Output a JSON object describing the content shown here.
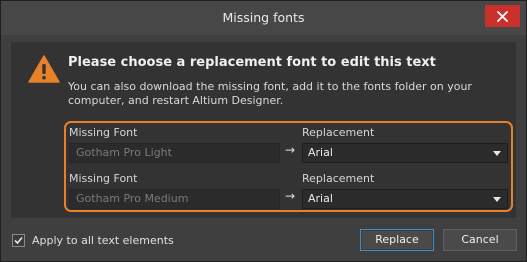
{
  "dialog": {
    "title": "Missing fonts",
    "close_icon": "close-icon"
  },
  "message": {
    "icon": "warning-icon",
    "heading": "Please choose a replacement font to edit this text",
    "description": "You can also download the missing font, add it to the fonts folder on your computer, and restart Altium Designer."
  },
  "rows": [
    {
      "missing_label": "Missing Font",
      "missing_value": "Gotham Pro Light",
      "arrow": "→",
      "replacement_label": "Replacement",
      "replacement_value": "Arial"
    },
    {
      "missing_label": "Missing Font",
      "missing_value": "Gotham Pro Medium",
      "arrow": "→",
      "replacement_label": "Replacement",
      "replacement_value": "Arial"
    }
  ],
  "footer": {
    "apply_all_label": "Apply to all text elements",
    "apply_all_checked": true,
    "replace_label": "Replace",
    "cancel_label": "Cancel"
  },
  "colors": {
    "highlight_border": "#e8802a",
    "warning": "#e8822a",
    "close_button": "#c9302c",
    "primary_button_border": "#3e8fd6"
  }
}
